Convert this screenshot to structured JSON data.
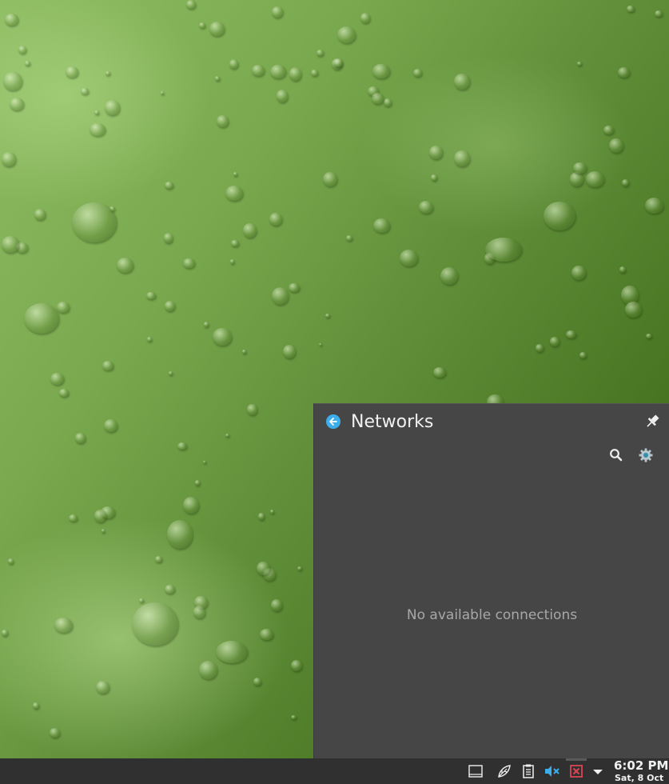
{
  "applet": {
    "title": "Networks",
    "empty_message": "No available connections"
  },
  "clock": {
    "time": "6:02 PM",
    "date": "Sat, 8 Oct"
  },
  "icons": {
    "back": "back-arrow-icon",
    "pin": "pin-icon",
    "search": "search-icon",
    "settings": "gear-icon",
    "tray": [
      "show-desktop-icon",
      "leaf-icon",
      "clipboard-icon",
      "volume-muted-icon",
      "network-disconnected-icon",
      "expand-arrow-icon"
    ]
  },
  "colors": {
    "panel_background": "#464646",
    "accent": "#3daee9",
    "network_disconnected": "#da4453",
    "taskbar": "#303030"
  }
}
